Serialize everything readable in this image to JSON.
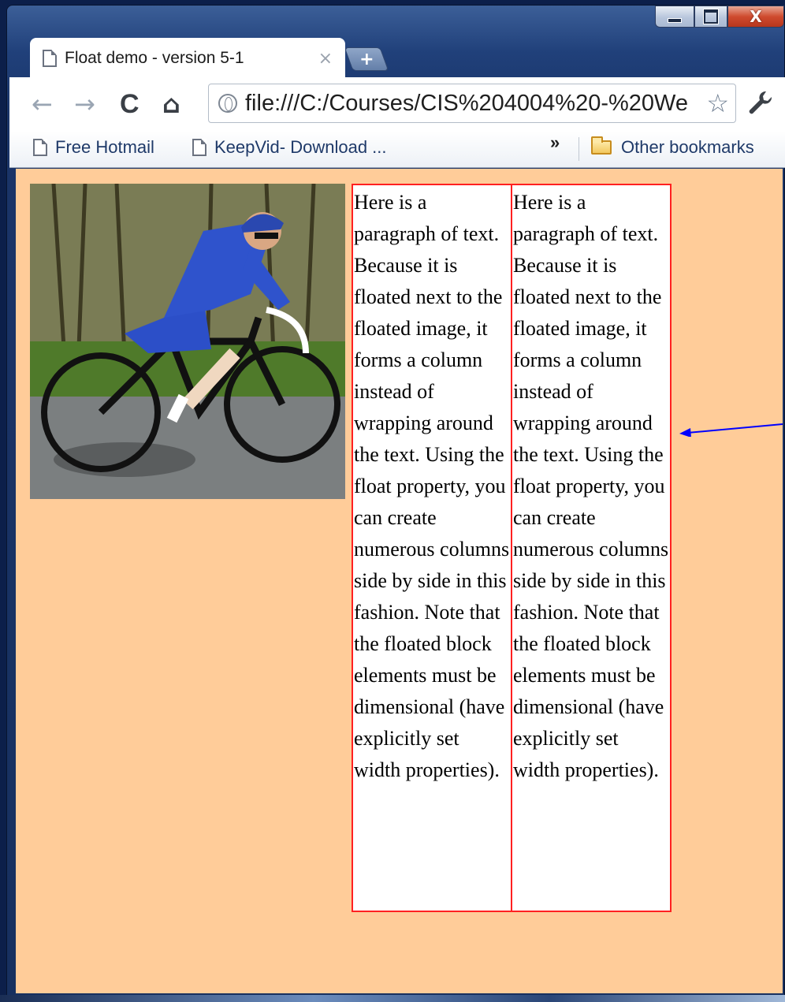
{
  "window": {
    "minimize_icon": "minimize-icon",
    "maximize_icon": "maximize-icon",
    "close_label": "X"
  },
  "tab": {
    "title": "Float demo - version 5-1",
    "close_label": "×",
    "new_tab_label": "+"
  },
  "toolbar": {
    "back_label": "←",
    "forward_label": "→",
    "reload_label": "C",
    "home_label": "⌂",
    "url": "file:///C:/Courses/CIS%204004%20-%20We",
    "star_label": "☆",
    "wrench_label": "🔧"
  },
  "bookmarks": {
    "items": [
      {
        "label": "Free Hotmail"
      },
      {
        "label": "KeepVid- Download ..."
      }
    ],
    "overflow_label": "»",
    "other_label": "Other bookmarks"
  },
  "page": {
    "background": "#ffcc99",
    "column_border_color": "#ff2020",
    "arrow_color": "#0000ff",
    "photo_alt": "cyclist-photo",
    "column_text": "Here is a paragraph of text. Because it is floated next to the floated image, it forms a column instead of wrapping around the text. Using the float property, you can create numerous columns side by side in this fashion. Note that the floated block elements must be dimensional (have explicitly set width properties).",
    "columns": [
      {
        "text": "Here is a paragraph of text. Because it is floated next to the floated image, it forms a column instead of wrapping around the text. Using the float property, you can create numerous columns side by side in this fashion. Note that the floated block elements must be dimensional (have explicitly set width properties)."
      },
      {
        "text": "Here is a paragraph of text. Because it is floated next to the floated image, it forms a column instead of wrapping around the text. Using the float property, you can create numerous columns side by side in this fashion. Note that the floated block elements must be dimensional (have explicitly set width properties)."
      }
    ]
  }
}
